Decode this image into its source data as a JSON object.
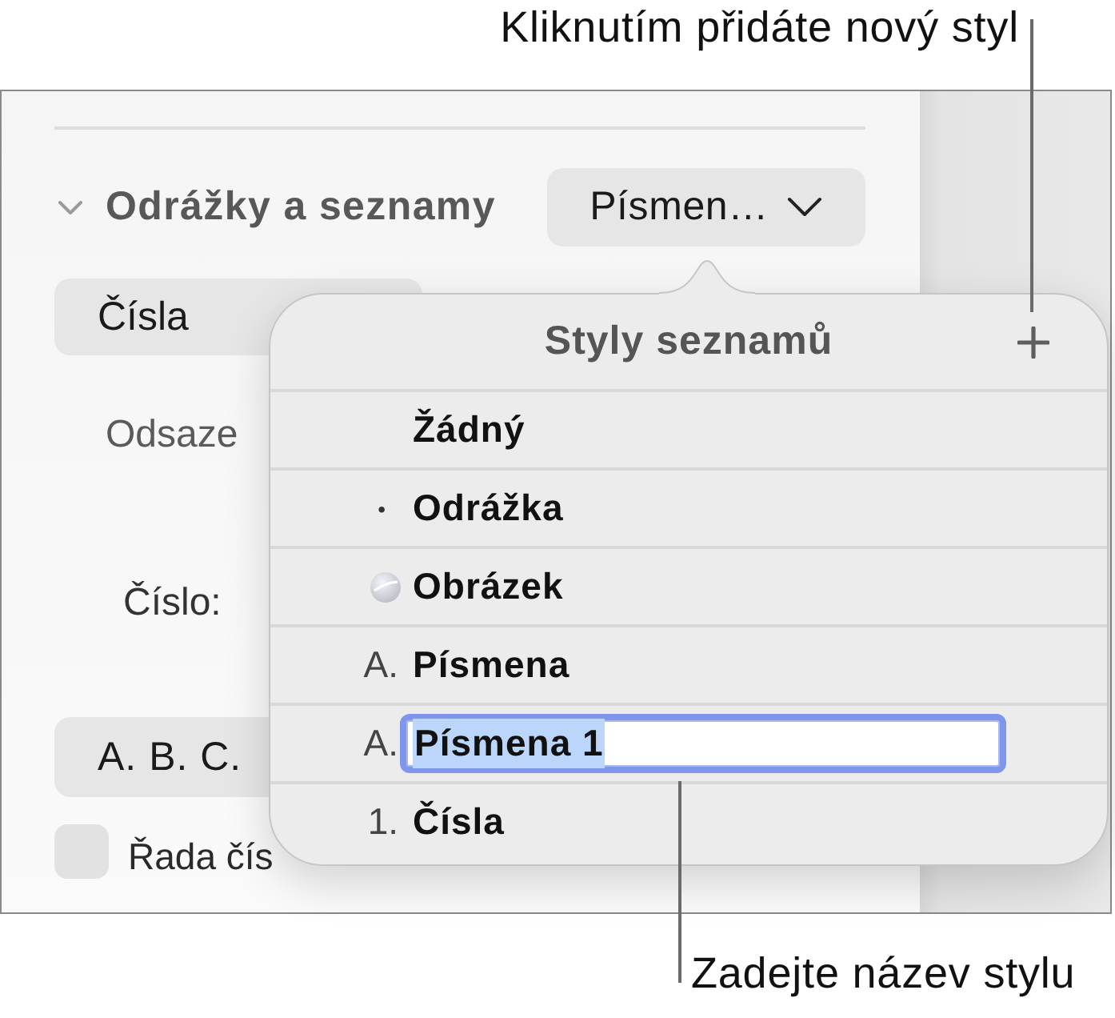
{
  "annotations": {
    "add_style": "Kliknutím přidáte nový styl",
    "style_name": "Zadejte název stylu"
  },
  "sidebar": {
    "section": {
      "title": "Odrážky a seznamy",
      "expanded": true,
      "style_popup": "Písmen…"
    },
    "list_type": "Čísla",
    "indent_label": "Odsaze",
    "number_label": "Číslo:",
    "number_format": "A. B. C.",
    "tiered_numbers": {
      "label": "Řada čís",
      "checked": false
    }
  },
  "popover": {
    "title": "Styly seznamů",
    "items": [
      {
        "kind": "plain",
        "label": "Žádný",
        "editing": false
      },
      {
        "kind": "bullet",
        "marker": "•",
        "label": "Odrážka",
        "editing": false
      },
      {
        "kind": "image",
        "label": "Obrázek",
        "editing": false
      },
      {
        "kind": "letter",
        "marker": "A.",
        "label": "Písmena",
        "editing": false
      },
      {
        "kind": "letter",
        "marker": "A.",
        "value": "Písmena 1",
        "editing": true,
        "value_selected": true
      },
      {
        "kind": "number",
        "marker": "1.",
        "label": "Čísla",
        "editing": false
      }
    ]
  }
}
